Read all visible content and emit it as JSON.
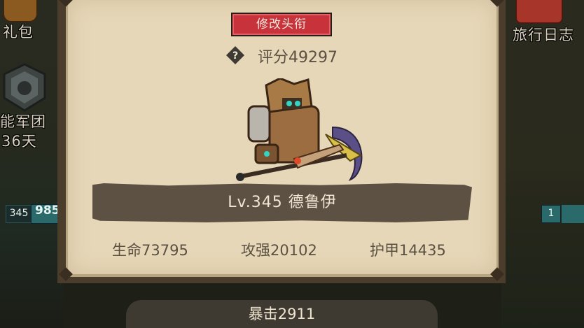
{
  "side": {
    "gift_label": "礼包",
    "guild_label": "能军团",
    "guild_days": "36天",
    "journal_label": "旅行日志",
    "left_level": "345",
    "left_value": "985",
    "right_level": "1"
  },
  "panel": {
    "rename_button": "修改头衔",
    "help_glyph": "?",
    "score": "评分49297",
    "hero_name": "Lv.345 德鲁伊",
    "stats": {
      "hp": "生命73795",
      "attack": "攻强20102",
      "armor": "护甲14435",
      "crit": "暴击2911"
    }
  },
  "colors": {
    "parchment": "#e6d7b8",
    "button_red": "#c8323a",
    "banner": "#5d5144",
    "text_brown": "#5b5142"
  },
  "icons": [
    "gift-icon",
    "guild-emblem-icon",
    "journal-icon",
    "help-icon",
    "hero-druid-figure"
  ]
}
